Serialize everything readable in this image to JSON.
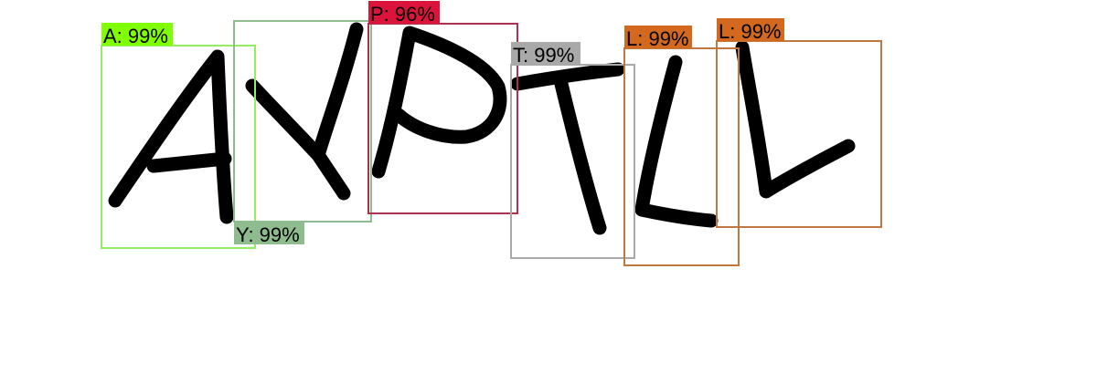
{
  "detections": [
    {
      "letter": "A",
      "label": "A: 99%",
      "color": "#7FFF00",
      "box_color": "#90EE60"
    },
    {
      "letter": "Y",
      "label": "Y: 99%",
      "color": "#8FBC8F",
      "box_color": "#8FBC8F"
    },
    {
      "letter": "P",
      "label": "P: 96%",
      "color": "#DC143C",
      "box_color": "#B03050"
    },
    {
      "letter": "T",
      "label": "T: 99%",
      "color": "#A9A9A9",
      "box_color": "#A9A9A9"
    },
    {
      "letter": "L",
      "label": "L: 99%",
      "color": "#D2691E",
      "box_color": "#C07840"
    },
    {
      "letter": "L",
      "label": "L: 99%",
      "color": "#D2691E",
      "box_color": "#C07840"
    }
  ]
}
